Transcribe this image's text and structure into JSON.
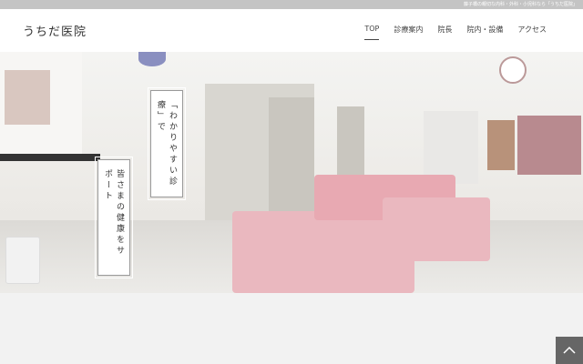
{
  "topbar": {
    "tagline": "藤子橋の親切な内科・外科・小児科なら「うちだ医院」"
  },
  "header": {
    "logo": "うちだ医院"
  },
  "nav": [
    {
      "label": "TOP"
    },
    {
      "label": "診療案内"
    },
    {
      "label": "院長"
    },
    {
      "label": "院内・設備"
    },
    {
      "label": "アクセス"
    }
  ],
  "hero": {
    "catch1": "「わかりやすい診療」で",
    "catch2": "皆さまの健康をサポート"
  }
}
